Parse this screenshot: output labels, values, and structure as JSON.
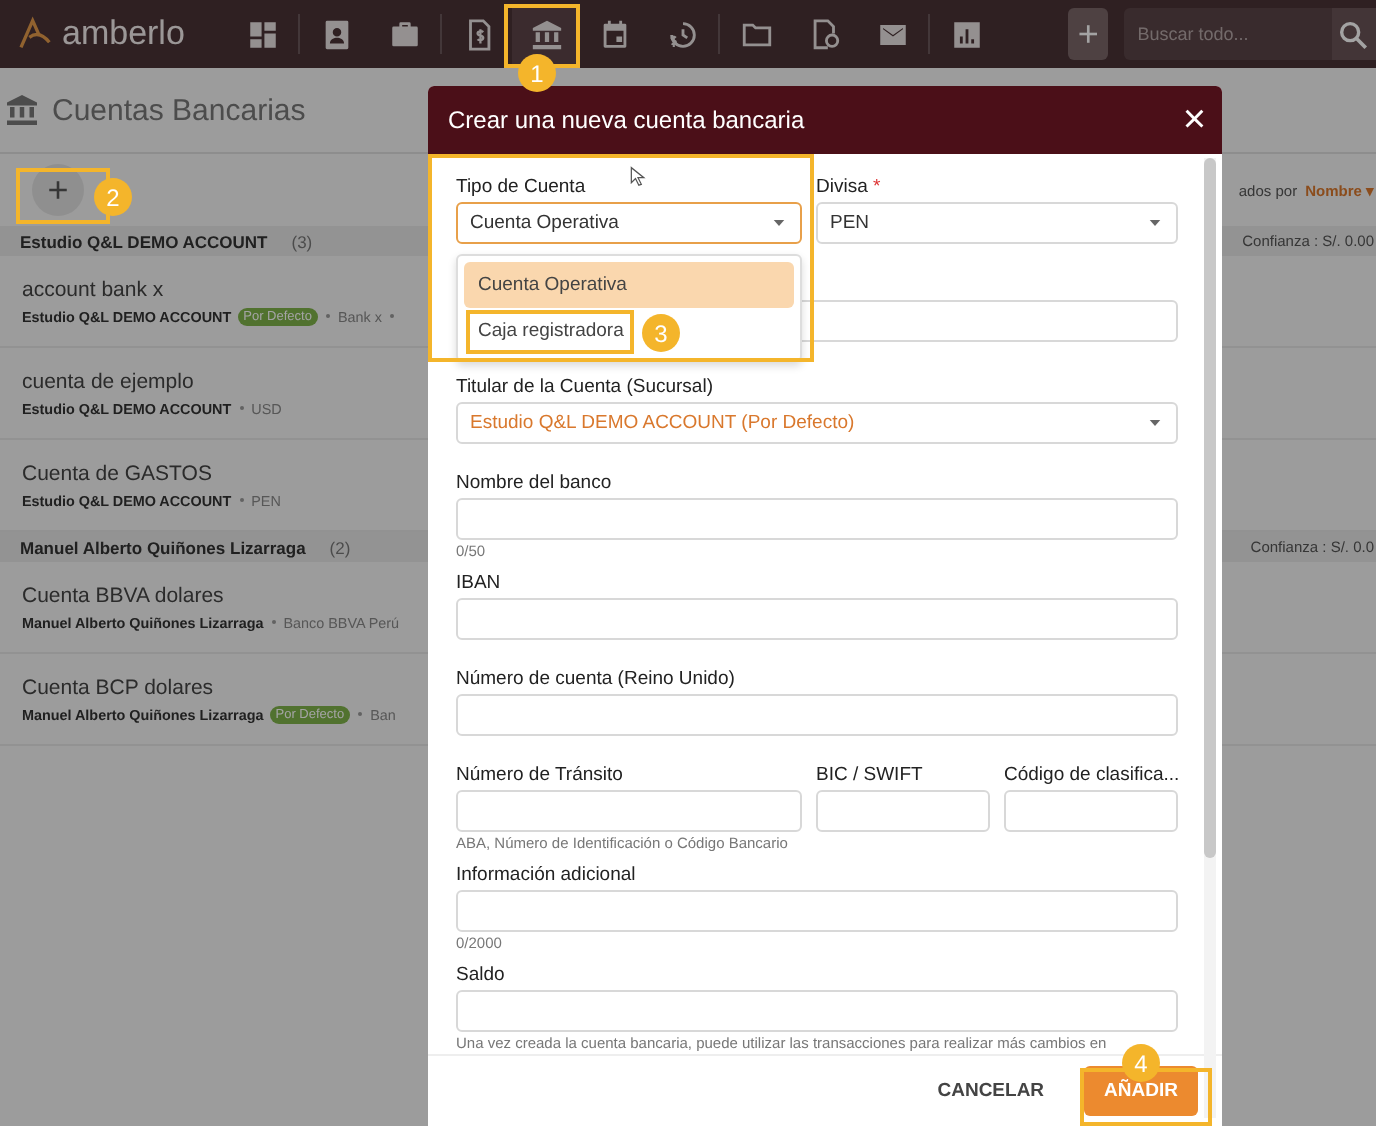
{
  "topbar": {
    "logo": "amberlo",
    "nav_groups": [
      [
        {
          "kind": "dashboard",
          "selected": false
        }
      ],
      [
        {
          "kind": "contact",
          "selected": false
        },
        {
          "kind": "briefcase",
          "selected": false
        }
      ],
      [
        {
          "kind": "invoice",
          "selected": false
        },
        {
          "kind": "bank",
          "selected": true
        },
        {
          "kind": "calendar",
          "selected": false
        },
        {
          "kind": "time",
          "selected": false
        }
      ],
      [
        {
          "kind": "folder",
          "selected": false
        },
        {
          "kind": "document",
          "selected": false
        },
        {
          "kind": "mail",
          "selected": false
        }
      ],
      [
        {
          "kind": "chart",
          "selected": false
        }
      ]
    ],
    "add_button": "+",
    "search": {
      "placeholder": "Buscar todo..."
    }
  },
  "page": {
    "title": "Cuentas Bancarias",
    "add_button": "+",
    "sort_label": "ados por",
    "sort_value": "Nombre",
    "sort_caret": "▾",
    "groups": [
      {
        "name": "Estudio Q&L DEMO ACCOUNT",
        "count": "(3)",
        "summary": "Confianza : S/. 0.00",
        "accounts": [
          {
            "name": "account bank x",
            "owner": "Estudio Q&L DEMO ACCOUNT",
            "default_badge": "Por Defecto",
            "meta": "Bank x",
            "trailing_dot": true
          },
          {
            "name": "cuenta de ejemplo",
            "owner": "Estudio Q&L DEMO ACCOUNT",
            "meta": "USD"
          },
          {
            "name": "Cuenta de GASTOS",
            "owner": "Estudio Q&L DEMO ACCOUNT",
            "meta": "PEN"
          }
        ]
      },
      {
        "name": "Manuel Alberto Quiñones Lizarraga",
        "count": "(2)",
        "summary": "Confianza : S/. 0.0",
        "accounts": [
          {
            "name": "Cuenta BBVA dolares",
            "owner": "Manuel Alberto Quiñones Lizarraga",
            "meta": "Banco BBVA Perú"
          },
          {
            "name": "Cuenta BCP dolares",
            "owner": "Manuel Alberto Quiñones Lizarraga",
            "default_badge": "Por Defecto",
            "meta": "Ban"
          }
        ]
      }
    ]
  },
  "dialog": {
    "title": "Crear una nueva cuenta bancaria",
    "close": "×",
    "account_type": {
      "label": "Tipo de Cuenta",
      "value": "Cuenta Operativa",
      "options": [
        {
          "label": "Cuenta Operativa",
          "selected": true
        },
        {
          "label": "Caja registradora",
          "selected": false
        }
      ]
    },
    "currency": {
      "label": "Divisa",
      "required": "*",
      "value": "PEN"
    },
    "holder": {
      "label": "Titular de la Cuenta (Sucursal)",
      "value": "Estudio Q&L DEMO ACCOUNT (Por Defecto)"
    },
    "bank_name": {
      "label": "Nombre del banco",
      "counter": "0/50"
    },
    "iban": {
      "label": "IBAN"
    },
    "uk_account": {
      "label": "Número de cuenta (Reino Unido)"
    },
    "transit": {
      "label": "Número de Tránsito",
      "hint": "ABA, Número de Identificación o Código Bancario"
    },
    "swift": {
      "label": "BIC / SWIFT"
    },
    "sort_code": {
      "label": "Código de clasifica..."
    },
    "additional_info": {
      "label": "Información adicional",
      "counter": "0/2000"
    },
    "balance": {
      "label": "Saldo",
      "hint": "Una vez creada la cuenta bancaria, puede utilizar las transacciones para realizar más cambios en"
    },
    "buttons": [
      {
        "label": "CANCELAR",
        "kind": "text"
      },
      {
        "label": "AÑADIR",
        "kind": "primary"
      }
    ]
  },
  "annotations": [
    {
      "number": "1"
    },
    {
      "number": "2"
    },
    {
      "number": "3"
    },
    {
      "number": "4"
    }
  ]
}
